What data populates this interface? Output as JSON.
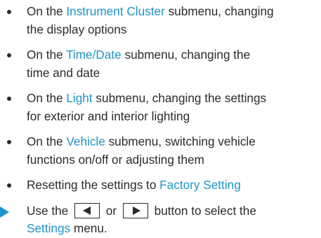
{
  "bullets": [
    {
      "lead": "On the ",
      "term": "Instrument Cluster",
      "line1_rest": " submenu, changing",
      "line2": "the display options"
    },
    {
      "lead": "On the ",
      "term": "Time/Date",
      "line1_rest": " submenu, changing the",
      "line2": "time and date"
    },
    {
      "lead": "On the ",
      "term": "Light",
      "line1_rest": " submenu, changing the settings",
      "line2": "for exterior and interior lighting"
    },
    {
      "lead": "On the ",
      "term": "Vehicle",
      "line1_rest": " submenu, switching vehicle",
      "line2": "functions on/off or adjusting them"
    },
    {
      "lead": "Resetting the settings to ",
      "term": "Factory Setting"
    }
  ],
  "step": {
    "use_the": "Use the",
    "or": "or",
    "button_to_select_the": "button to select the",
    "menu_name": "Settings",
    "menu_suffix": " menu.",
    "left_key_icon": "left-arrow-key-icon",
    "right_key_icon": "right-arrow-key-icon"
  },
  "colors": {
    "highlight": "#1f93c9",
    "text": "#2b2b2b"
  }
}
